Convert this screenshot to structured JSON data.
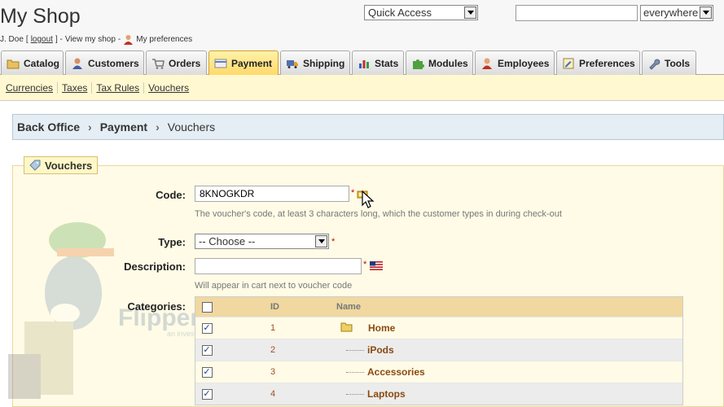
{
  "header": {
    "shop_title": "My Shop",
    "user_name": "J. Doe",
    "logout_label": "logout",
    "view_shop_label": "View my shop",
    "preferences_label": "My preferences",
    "quick_access_label": "Quick Access",
    "search_value": "",
    "search_scope": "everywhere"
  },
  "tabs": [
    {
      "label": "Catalog",
      "icon": "folder-icon"
    },
    {
      "label": "Customers",
      "icon": "user-icon"
    },
    {
      "label": "Orders",
      "icon": "cart-icon"
    },
    {
      "label": "Payment",
      "icon": "payment-icon",
      "active": true
    },
    {
      "label": "Shipping",
      "icon": "truck-icon"
    },
    {
      "label": "Stats",
      "icon": "chart-icon"
    },
    {
      "label": "Modules",
      "icon": "puzzle-icon"
    },
    {
      "label": "Employees",
      "icon": "employee-icon"
    },
    {
      "label": "Preferences",
      "icon": "preferences-icon"
    },
    {
      "label": "Tools",
      "icon": "wrench-icon"
    }
  ],
  "subtabs": [
    "Currencies",
    "Taxes",
    "Tax Rules",
    "Vouchers"
  ],
  "breadcrumb": [
    "Back Office",
    "Payment",
    "Vouchers"
  ],
  "form": {
    "legend": "Vouchers",
    "code_label": "Code:",
    "code_value": "8KNOGKDR",
    "code_hint": "The voucher's code, at least 3 characters long, which the customer types in during check-out",
    "type_label": "Type:",
    "type_value": "-- Choose --",
    "description_label": "Description:",
    "description_value": "",
    "description_hint": "Will appear in cart next to voucher code",
    "categories_label": "Categories:",
    "required_mark": "*"
  },
  "categories": {
    "headers": {
      "id": "ID",
      "name": "Name"
    },
    "rows": [
      {
        "id": "1",
        "name": "Home",
        "checked": true
      },
      {
        "id": "2",
        "name": "iPods",
        "checked": true
      },
      {
        "id": "3",
        "name": "Accessories",
        "checked": true
      },
      {
        "id": "4",
        "name": "Laptops",
        "checked": true
      }
    ]
  },
  "watermark": {
    "brand": "FlipperHost",
    "tagline": "an investment company"
  },
  "colors": {
    "active_tab": "#ffd868",
    "subtab_bar": "#fff8d0",
    "breadcrumb_bg": "#e4eef4",
    "category_name": "#8a4a10"
  }
}
